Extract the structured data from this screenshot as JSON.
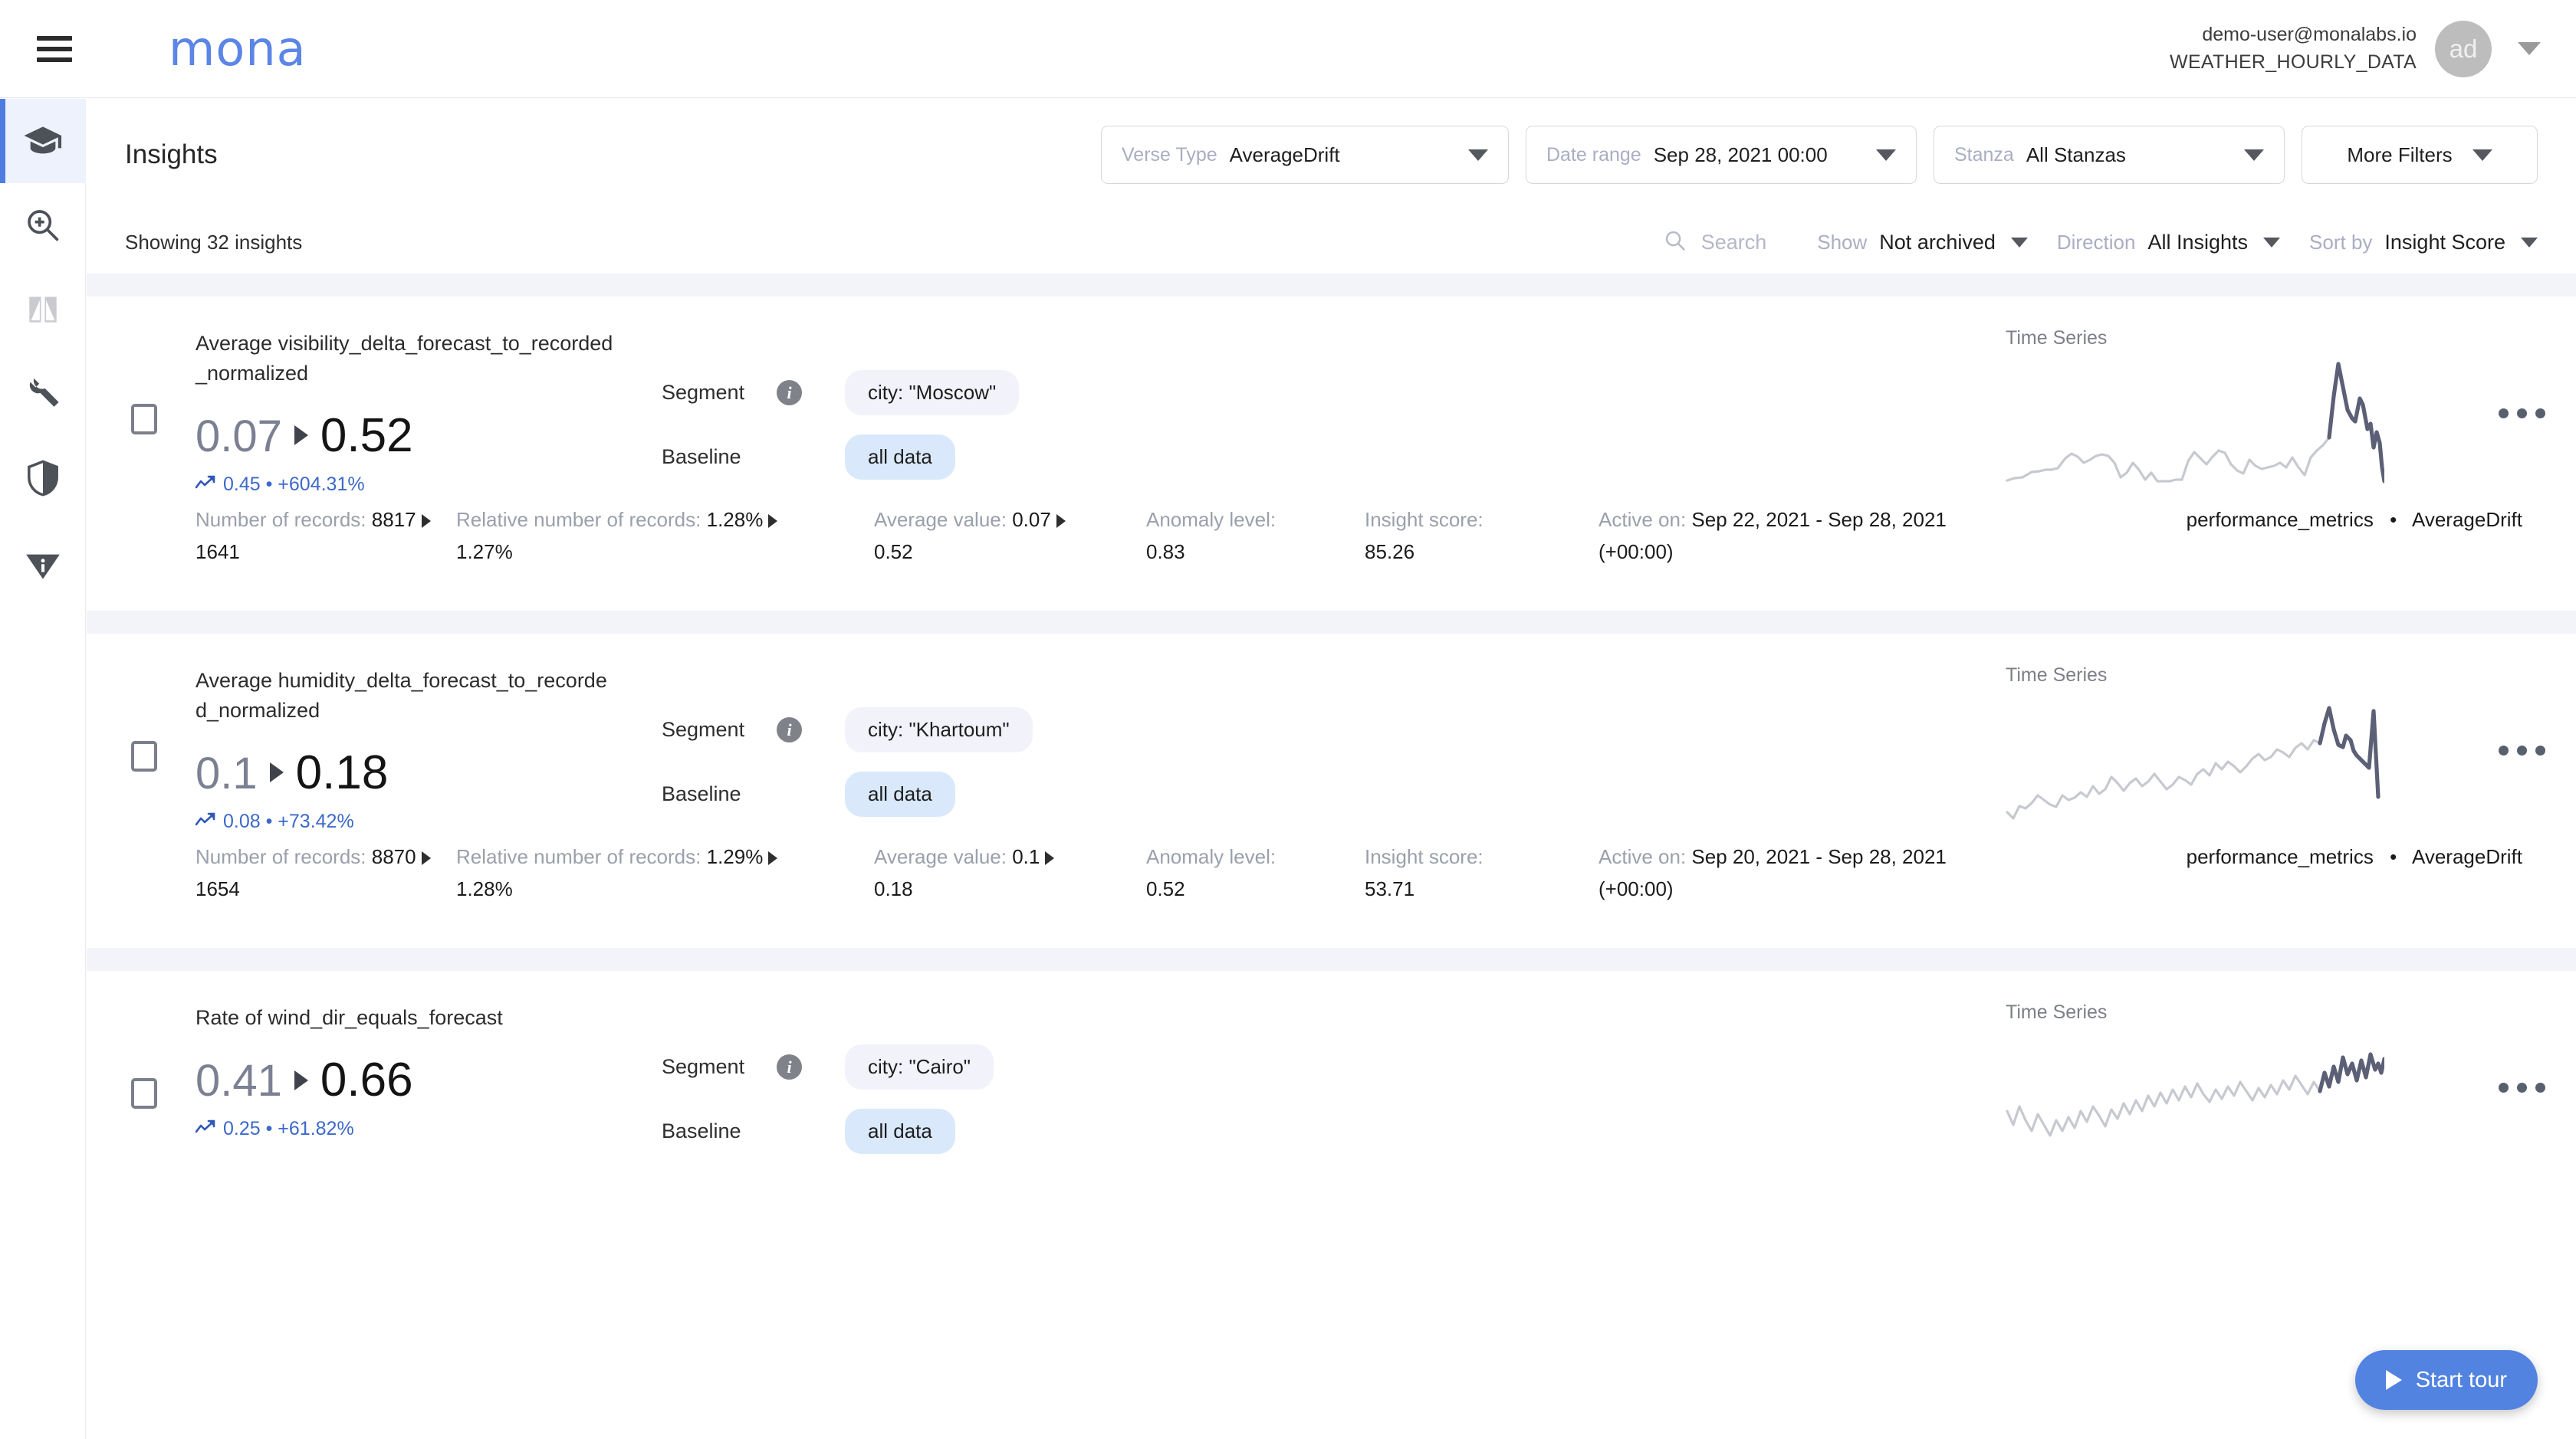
{
  "header": {
    "brand": "mona",
    "menu_icon": "hamburger-icon",
    "user_email": "demo-user@monalabs.io",
    "user_context": "WEATHER_HOURLY_DATA",
    "avatar_initials": "ad"
  },
  "sidebar": {
    "items": [
      {
        "name": "insights",
        "icon": "graduation-cap-icon",
        "active": true
      },
      {
        "name": "investigation",
        "icon": "zoom-in-icon",
        "active": false
      },
      {
        "name": "compare",
        "icon": "compare-split-icon",
        "active": false
      },
      {
        "name": "configuration",
        "icon": "wrench-icon",
        "active": false
      },
      {
        "name": "security",
        "icon": "shield-icon",
        "active": false
      },
      {
        "name": "info",
        "icon": "info-triangle-icon",
        "active": false
      }
    ]
  },
  "page": {
    "title": "Insights",
    "showing": "Showing 32 insights"
  },
  "filters": [
    {
      "label": "Verse Type",
      "value": "AverageDrift"
    },
    {
      "label": "Date range",
      "value": "Sep 28, 2021 00:00"
    },
    {
      "label": "Stanza",
      "value": "All Stanzas"
    }
  ],
  "more_filters_label": "More Filters",
  "search": {
    "placeholder": "Search",
    "icon": "search-icon"
  },
  "controls": [
    {
      "label": "Show",
      "value": "Not archived"
    },
    {
      "label": "Direction",
      "value": "All Insights"
    },
    {
      "label": "Sort by",
      "value": "Insight Score"
    }
  ],
  "labels": {
    "segment": "Segment",
    "baseline": "Baseline",
    "time_series": "Time Series",
    "records": "Number of records:",
    "relative": "Relative number of records:",
    "average": "Average value:",
    "anomaly": "Anomaly level:",
    "insight_score": "Insight score:",
    "active_on": "Active on:"
  },
  "start_tour": "Start tour",
  "insights": [
    {
      "title": "Average visibility_delta_forecast_to_recorded_normalized",
      "from": "0.07",
      "to": "0.52",
      "delta": "0.45 • +604.31%",
      "segment": "city: \"Moscow\"",
      "baseline": "all data",
      "records_top": "8817",
      "records_bottom": "1641",
      "relative_top": "1.28%",
      "relative_bottom": "1.27%",
      "average_top": "0.07",
      "average_bottom": "0.52",
      "anomaly": "0.83",
      "insight_score": "85.26",
      "active_range": "Sep 22, 2021 - Sep 28, 2021",
      "active_tz": "(+00:00)",
      "tag_context": "performance_metrics",
      "tag_verse": "AverageDrift"
    },
    {
      "title": "Average humidity_delta_forecast_to_recorded_normalized",
      "from": "0.1",
      "to": "0.18",
      "delta": "0.08 • +73.42%",
      "segment": "city: \"Khartoum\"",
      "baseline": "all data",
      "records_top": "8870",
      "records_bottom": "1654",
      "relative_top": "1.29%",
      "relative_bottom": "1.28%",
      "average_top": "0.1",
      "average_bottom": "0.18",
      "anomaly": "0.52",
      "insight_score": "53.71",
      "active_range": "Sep 20, 2021 - Sep 28, 2021",
      "active_tz": "(+00:00)",
      "tag_context": "performance_metrics",
      "tag_verse": "AverageDrift"
    },
    {
      "title": "Rate of wind_dir_equals_forecast",
      "from": "0.41",
      "to": "0.66",
      "delta": "0.25 • +61.82%",
      "segment": "city: \"Cairo\"",
      "baseline": "all data"
    }
  ],
  "chart_data": [
    {
      "type": "line",
      "title": "Time Series",
      "series": [
        {
          "name": "baseline",
          "values": [
            4,
            6,
            5,
            10,
            11,
            12,
            12,
            13,
            22,
            26,
            24,
            20,
            22,
            24,
            25,
            24,
            20,
            10,
            13,
            20,
            15,
            8,
            13,
            6,
            6,
            6,
            7,
            7,
            18,
            26,
            22,
            18,
            24,
            27,
            26,
            18,
            14,
            12,
            21,
            17,
            15,
            16,
            17,
            19,
            16,
            22,
            16,
            11,
            22,
            27,
            30,
            34
          ]
        },
        {
          "name": "recent",
          "values": [
            34,
            60,
            96,
            74,
            52,
            46,
            44,
            62,
            58,
            34,
            44,
            28,
            48,
            56,
            22,
            8
          ]
        }
      ],
      "ylim": [
        0,
        100
      ],
      "grid": false,
      "legend": "none"
    },
    {
      "type": "line",
      "title": "Time Series",
      "series": [
        {
          "name": "baseline",
          "values": [
            14,
            8,
            18,
            16,
            20,
            26,
            22,
            18,
            16,
            26,
            22,
            24,
            28,
            24,
            32,
            26,
            30,
            40,
            34,
            28,
            34,
            38,
            32,
            36,
            42,
            36,
            30,
            34,
            40,
            38,
            34,
            42,
            46,
            40,
            50,
            44,
            52,
            48,
            44,
            50,
            56,
            60,
            54,
            58,
            64,
            62,
            58,
            66,
            70,
            64,
            72,
            70
          ]
        },
        {
          "name": "recent",
          "values": [
            70,
            86,
            94,
            74,
            62,
            60,
            70,
            66,
            58,
            54,
            52,
            50,
            48,
            46,
            90,
            30
          ]
        }
      ],
      "ylim": [
        0,
        100
      ],
      "grid": false,
      "legend": "none"
    },
    {
      "type": "line",
      "title": "Time Series",
      "series": [
        {
          "name": "baseline",
          "values": [
            40,
            30,
            44,
            34,
            26,
            38,
            30,
            22,
            34,
            26,
            36,
            28,
            40,
            32,
            44,
            38,
            30,
            42,
            36,
            48,
            40,
            52,
            44,
            56,
            48,
            60,
            52,
            64,
            56,
            68,
            60,
            72,
            64,
            58,
            70,
            62,
            74,
            66,
            78,
            70,
            62,
            74,
            66,
            78,
            70,
            82,
            74,
            86,
            78,
            70,
            82,
            74
          ]
        },
        {
          "name": "recent",
          "values": [
            74,
            88,
            78,
            92,
            82,
            96,
            86,
            90,
            80,
            94,
            84,
            98,
            88,
            92,
            86,
            96
          ]
        }
      ],
      "ylim": [
        0,
        100
      ],
      "grid": false,
      "legend": "none"
    }
  ]
}
